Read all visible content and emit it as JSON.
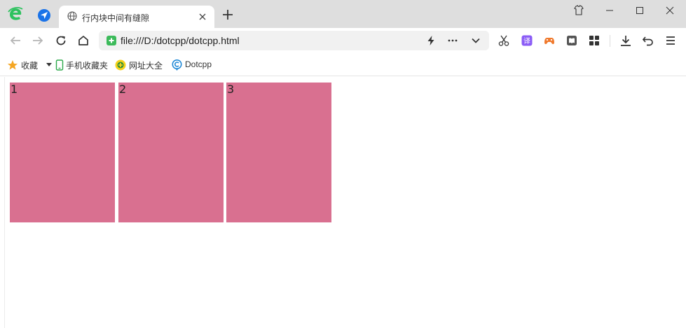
{
  "browser": {
    "tab": {
      "title": "行内块中间有缝隙"
    },
    "address": {
      "url": "file:///D:/dotcpp/dotcpp.html"
    },
    "bookmarks": [
      {
        "label": "收藏",
        "icon": "star-icon"
      },
      {
        "label": "手机收藏夹",
        "icon": "phone-icon"
      },
      {
        "label": "网址大全",
        "icon": "sites-icon"
      },
      {
        "label": "Dotcpp",
        "icon": "dotcpp-icon"
      }
    ],
    "colors": {
      "accent": "#1a73e8",
      "secure": "#3cba5a",
      "tabstrip": "#dedede"
    }
  },
  "page": {
    "blocks": [
      {
        "label": "1"
      },
      {
        "label": "2"
      },
      {
        "label": "3"
      }
    ],
    "block_color": "#d97090"
  }
}
